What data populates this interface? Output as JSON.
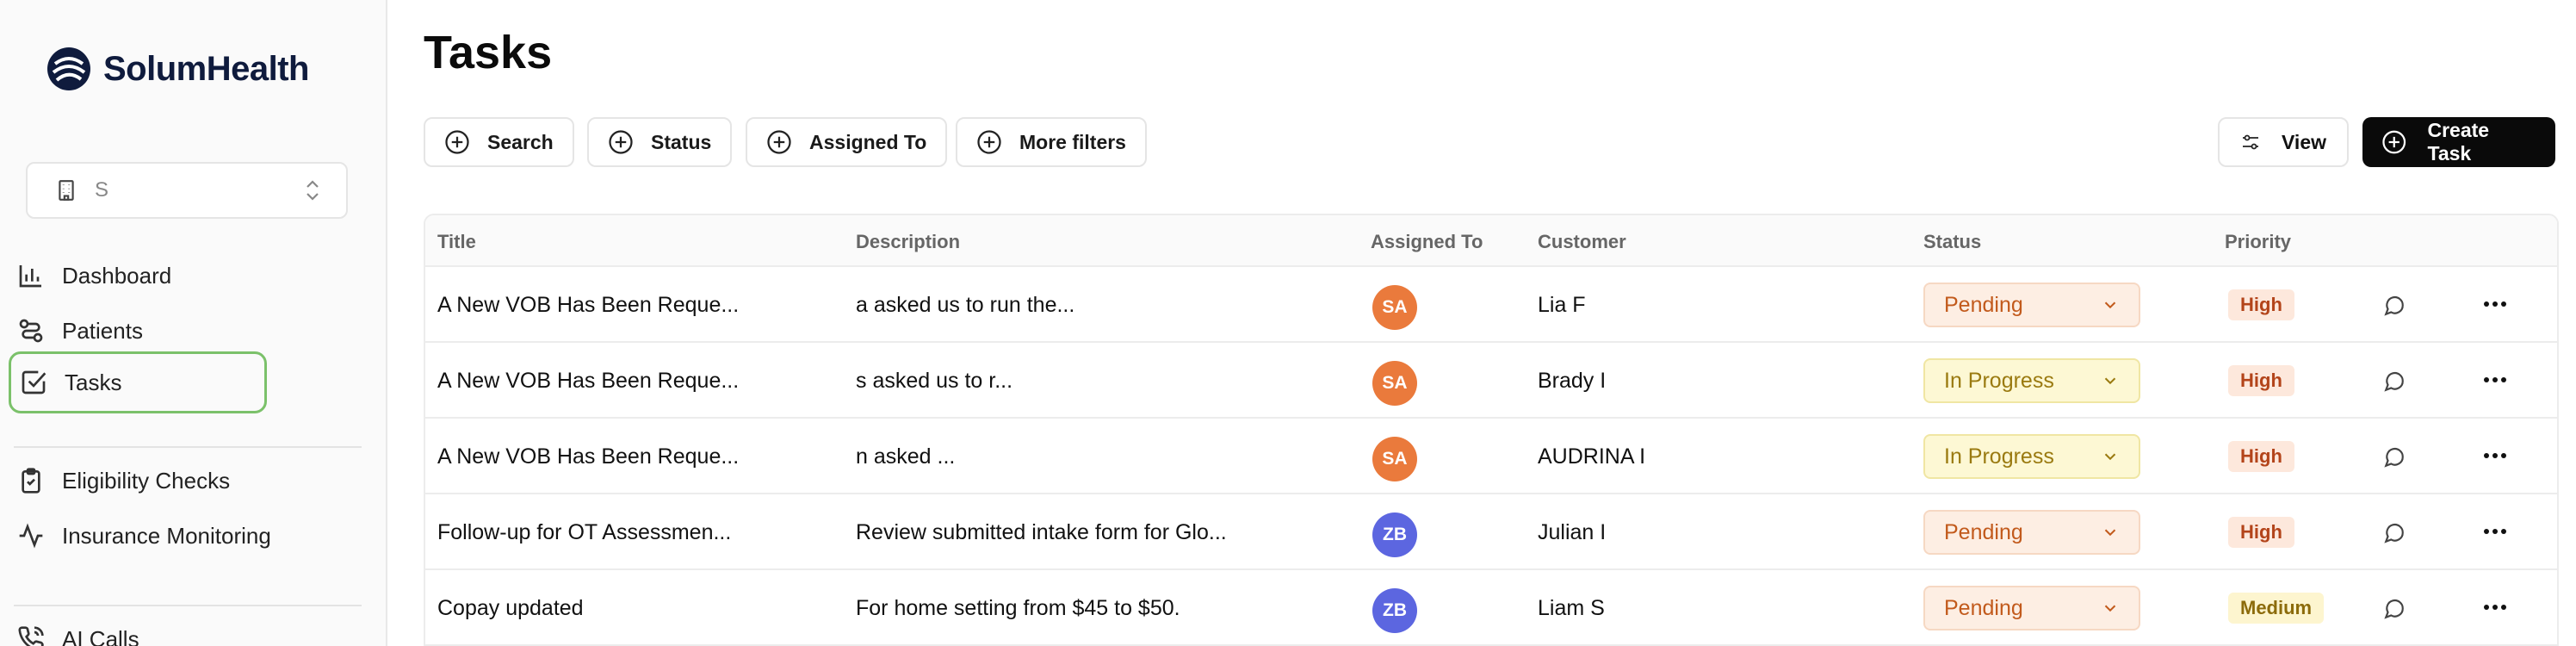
{
  "brand": {
    "name_bold": "Solum",
    "name_rest": "Health"
  },
  "org_select": {
    "value": "S"
  },
  "nav": {
    "items": [
      {
        "label": "Dashboard"
      },
      {
        "label": "Patients"
      },
      {
        "label": "Tasks"
      },
      {
        "label": "Eligibility Checks"
      },
      {
        "label": "Insurance Monitoring"
      },
      {
        "label": "AI Calls"
      }
    ]
  },
  "page": {
    "title": "Tasks"
  },
  "filters": {
    "search": "Search",
    "status": "Status",
    "assigned_to": "Assigned To",
    "more": "More filters"
  },
  "actions": {
    "view": "View",
    "create": "Create Task"
  },
  "table": {
    "headers": {
      "title": "Title",
      "description": "Description",
      "assigned_to": "Assigned To",
      "customer": "Customer",
      "status": "Status",
      "priority": "Priority"
    },
    "rows": [
      {
        "title": "A New VOB Has Been Reque...",
        "description": "a asked us to run the...",
        "assignee": "SA",
        "customer": "Lia F",
        "status": "Pending",
        "priority": "High"
      },
      {
        "title": "A New VOB Has Been Reque...",
        "description": "s asked us to r...",
        "assignee": "SA",
        "customer": "Brady I",
        "status": "In Progress",
        "priority": "High"
      },
      {
        "title": "A New VOB Has Been Reque...",
        "description": "n asked ...",
        "assignee": "SA",
        "customer": "AUDRINA I",
        "status": "In Progress",
        "priority": "High"
      },
      {
        "title": "Follow-up for OT Assessmen...",
        "description": "Review submitted intake form for Glo...",
        "assignee": "ZB",
        "customer": "Julian I",
        "status": "Pending",
        "priority": "High"
      },
      {
        "title": "Copay updated",
        "description": "For home setting from $45 to $50.",
        "assignee": "ZB",
        "customer": "Liam S",
        "status": "Pending",
        "priority": "Medium"
      }
    ]
  },
  "colors": {
    "avatar_sa": "#ea7a3c",
    "avatar_zb": "#5c66e0",
    "active_nav_border": "#7bc16a",
    "primary_button": "#0a0a0a"
  }
}
